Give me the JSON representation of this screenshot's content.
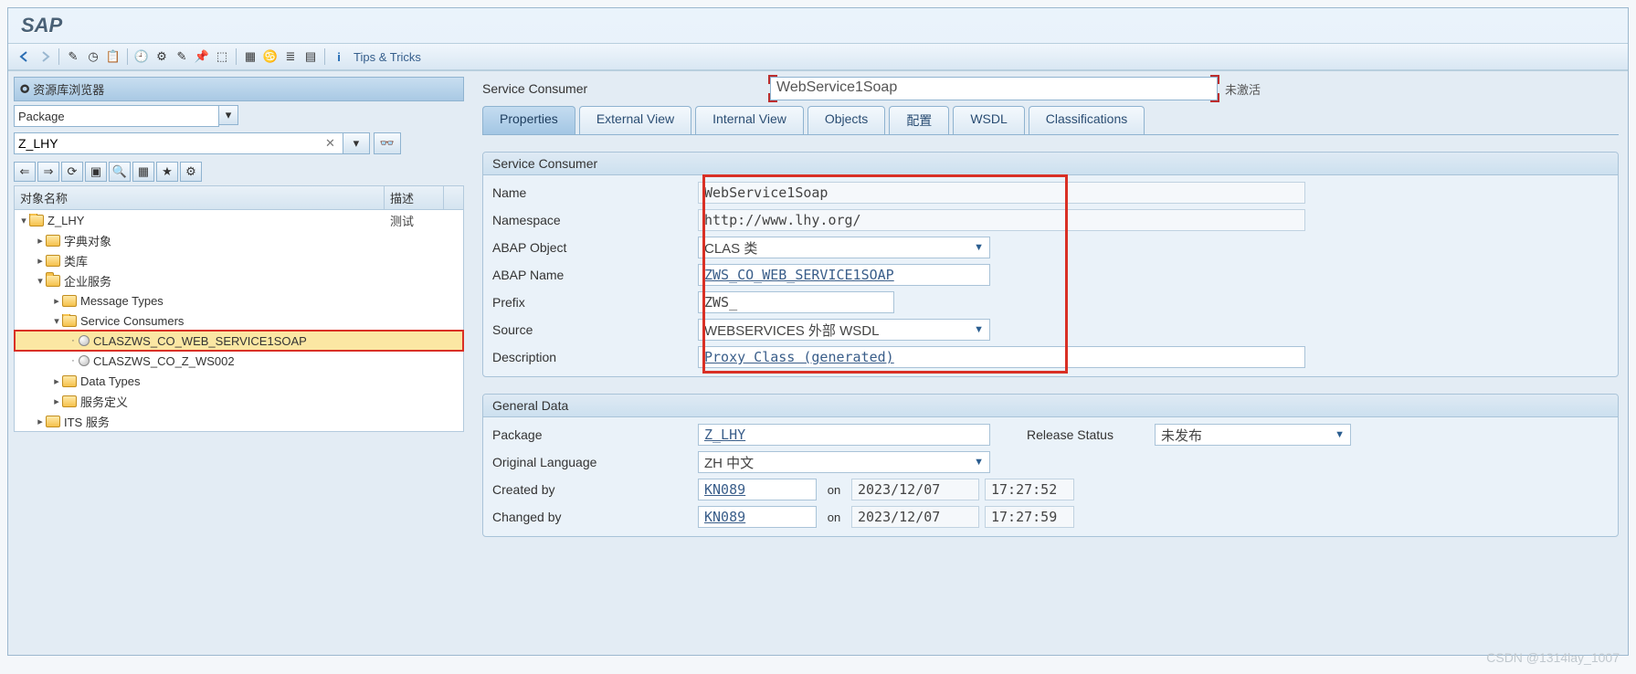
{
  "app": {
    "title": "SAP"
  },
  "toolbar": {
    "tips": "Tips & Tricks"
  },
  "repo_browser": {
    "title": "资源库浏览器",
    "selector": "Package",
    "search_value": "Z_LHY"
  },
  "tree": {
    "col_name": "对象名称",
    "col_desc": "描述",
    "root": {
      "label": "Z_LHY",
      "desc": "测试"
    },
    "n1": "字典对象",
    "n2": "类库",
    "n3": "企业服务",
    "n3a": "Message Types",
    "n3b": "Service Consumers",
    "n3b1": "CLASZWS_CO_WEB_SERVICE1SOAP",
    "n3b2": "CLASZWS_CO_Z_WS002",
    "n3c": "Data Types",
    "n3d": "服务定义",
    "n4": "ITS 服务"
  },
  "header": {
    "label": "Service Consumer",
    "value": "WebService1Soap",
    "status": "未激活"
  },
  "tabs": {
    "t1": "Properties",
    "t2": "External View",
    "t3": "Internal View",
    "t4": "Objects",
    "t5": "配置",
    "t6": "WSDL",
    "t7": "Classifications"
  },
  "sc_group": {
    "title": "Service Consumer",
    "name_lbl": "Name",
    "name_val": "WebService1Soap",
    "ns_lbl": "Namespace",
    "ns_val": "http://www.lhy.org/",
    "abapobj_lbl": "ABAP Object",
    "abapobj_val": "CLAS 类",
    "abapname_lbl": "ABAP Name",
    "abapname_val": "ZWS_CO_WEB_SERVICE1SOAP",
    "prefix_lbl": "Prefix",
    "prefix_val": "ZWS_",
    "source_lbl": "Source",
    "source_val": "WEBSERVICES 外部 WSDL",
    "desc_lbl": "Description",
    "desc_val": "Proxy Class (generated)"
  },
  "gen_group": {
    "title": "General Data",
    "pkg_lbl": "Package",
    "pkg_val": "Z_LHY",
    "rel_lbl": "Release Status",
    "rel_val": "未发布",
    "lang_lbl": "Original Language",
    "lang_val": "ZH 中文",
    "crtby_lbl": "Created by",
    "crtby_val": "KN089",
    "on": "on",
    "crt_date": "2023/12/07",
    "crt_time": "17:27:52",
    "chgby_lbl": "Changed by",
    "chgby_val": "KN089",
    "chg_date": "2023/12/07",
    "chg_time": "17:27:59"
  },
  "watermark": "CSDN @1314lay_1007"
}
